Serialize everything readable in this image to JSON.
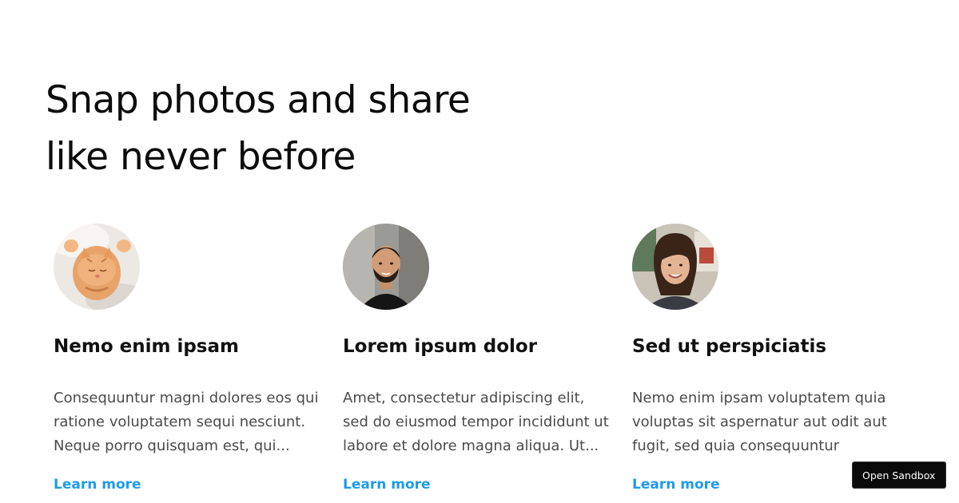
{
  "headline": "Snap photos and share like never before",
  "cards": [
    {
      "avatar_icon": "kitten-avatar",
      "title": "Nemo enim ipsam",
      "text": "Consequuntur magni dolores eos qui ratione voluptatem sequi nesciunt. Neque porro quisquam est, qui...",
      "link": "Learn more"
    },
    {
      "avatar_icon": "man-avatar",
      "title": "Lorem ipsum dolor",
      "text": "Amet, consectetur adipiscing elit, sed do eiusmod tempor incididunt ut labore et dolore magna aliqua. Ut...",
      "link": "Learn more"
    },
    {
      "avatar_icon": "woman-avatar",
      "title": "Sed ut perspiciatis",
      "text": "Nemo enim ipsam voluptatem quia voluptas sit aspernatur aut odit aut fugit, sed quia consequuntur magni...",
      "link": "Learn more"
    }
  ],
  "sandbox_button": "Open Sandbox",
  "colors": {
    "link": "#1e9be8",
    "heading": "#0c0c0c",
    "body_text": "#4a4a4a"
  }
}
